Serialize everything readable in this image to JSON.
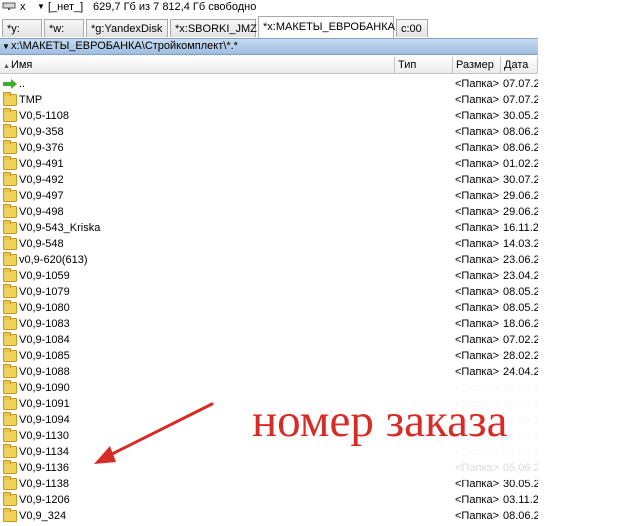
{
  "drive_info": {
    "drive": "x",
    "label": "[_нет_]",
    "free": "629,7 Гб из 7 812,4 Гб свободно"
  },
  "tabs": [
    {
      "label": "*y:"
    },
    {
      "label": "*w:"
    },
    {
      "label": "*g:YandexDisk"
    },
    {
      "label": "*x:SBORKI_JMZ"
    },
    {
      "label": "*x:МАКЕТЫ_ЕВРОБАНКА"
    },
    {
      "label": "c:00"
    }
  ],
  "path": "x:\\МАКЕТЫ_ЕВРОБАНКА\\Стройкомплект\\*.*",
  "columns": {
    "name": "Имя",
    "type": "Тип",
    "size": "Размер",
    "date": "Дата"
  },
  "rows": [
    {
      "name": "..",
      "size": "<Папка>",
      "date": "07.07.2"
    },
    {
      "name": "TMP",
      "size": "<Папка>",
      "date": "07.07.2"
    },
    {
      "name": "V0,5-1108",
      "size": "<Папка>",
      "date": "30.05.2"
    },
    {
      "name": "V0,9-358",
      "size": "<Папка>",
      "date": "08.06.2"
    },
    {
      "name": "V0,9-376",
      "size": "<Папка>",
      "date": "08.06.2"
    },
    {
      "name": "V0,9-491",
      "size": "<Папка>",
      "date": "01.02.2"
    },
    {
      "name": "V0,9-492",
      "size": "<Папка>",
      "date": "30.07.2"
    },
    {
      "name": "V0,9-497",
      "size": "<Папка>",
      "date": "29.06.2"
    },
    {
      "name": "V0,9-498",
      "size": "<Папка>",
      "date": "29.06.2"
    },
    {
      "name": "V0,9-543_Kriska",
      "size": "<Папка>",
      "date": "16.11.2"
    },
    {
      "name": "V0,9-548",
      "size": "<Папка>",
      "date": "14.03.2"
    },
    {
      "name": "v0,9-620(613)",
      "size": "<Папка>",
      "date": "23.06.2"
    },
    {
      "name": "V0,9-1059",
      "size": "<Папка>",
      "date": "23.04.2"
    },
    {
      "name": "V0,9-1079",
      "size": "<Папка>",
      "date": "08.05.2"
    },
    {
      "name": "V0,9-1080",
      "size": "<Папка>",
      "date": "08.05.2"
    },
    {
      "name": "V0,9-1083",
      "size": "<Папка>",
      "date": "18.06.2"
    },
    {
      "name": "V0,9-1084",
      "size": "<Папка>",
      "date": "07.02.2"
    },
    {
      "name": "V0,9-1085",
      "size": "<Папка>",
      "date": "28.02.2"
    },
    {
      "name": "V0,9-1088",
      "size": "<Папка>",
      "date": "24.04.2"
    },
    {
      "name": "V0,9-1090",
      "size": "<Папка>",
      "date": "15.08.2"
    },
    {
      "name": "V0,9-1091",
      "size": "<Папка>",
      "date": "20.08.2"
    },
    {
      "name": "V0,9-1094",
      "size": "<Папка>",
      "date": "05.09.2"
    },
    {
      "name": "V0,9-1130",
      "size": "<Папка>",
      "date": "16.04.2"
    },
    {
      "name": "V0,9-1134",
      "size": "<Папка>",
      "date": "01.08.2"
    },
    {
      "name": "V0,9-1136",
      "size": "<Папка>",
      "date": "05.06.2"
    },
    {
      "name": "V0,9-1138",
      "size": "<Папка>",
      "date": "30.05.2"
    },
    {
      "name": "V0,9-1206",
      "size": "<Папка>",
      "date": "03.11.2"
    },
    {
      "name": "V0,9_324",
      "size": "<Папка>",
      "date": "08.06.2"
    }
  ],
  "annotation": {
    "text": "номер заказа",
    "color": "#d92b26"
  },
  "colors": {
    "path_bar": "#aec8e8",
    "folder": "#f2d15a",
    "up_arrow": "#3cae2e"
  }
}
